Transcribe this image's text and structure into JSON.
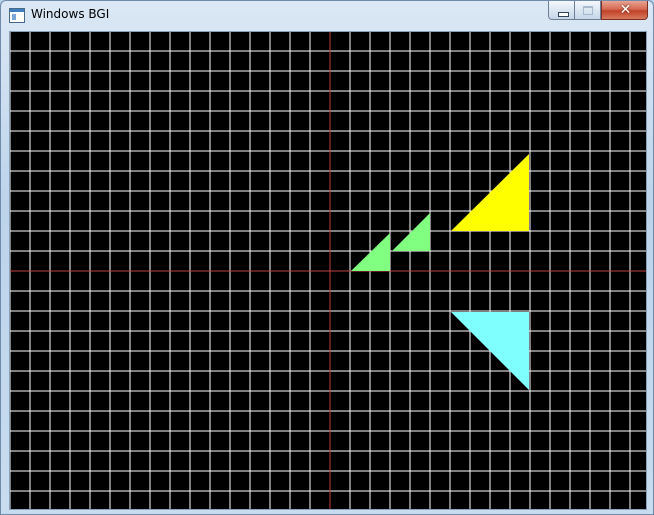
{
  "window": {
    "title": "Windows BGI",
    "buttons": {
      "minimize": "minimize-button",
      "maximize": "maximize-button",
      "close": "close-button"
    }
  },
  "canvas": {
    "background": "#000000",
    "grid_color": "#ffffff",
    "axes_color": "#c04040",
    "shapes": [
      {
        "kind": "triangle",
        "color": "#ffff00"
      },
      {
        "kind": "triangle",
        "color": "#80ff80"
      },
      {
        "kind": "triangle",
        "color": "#80ff80"
      },
      {
        "kind": "triangle",
        "color": "#80ffff"
      }
    ]
  }
}
